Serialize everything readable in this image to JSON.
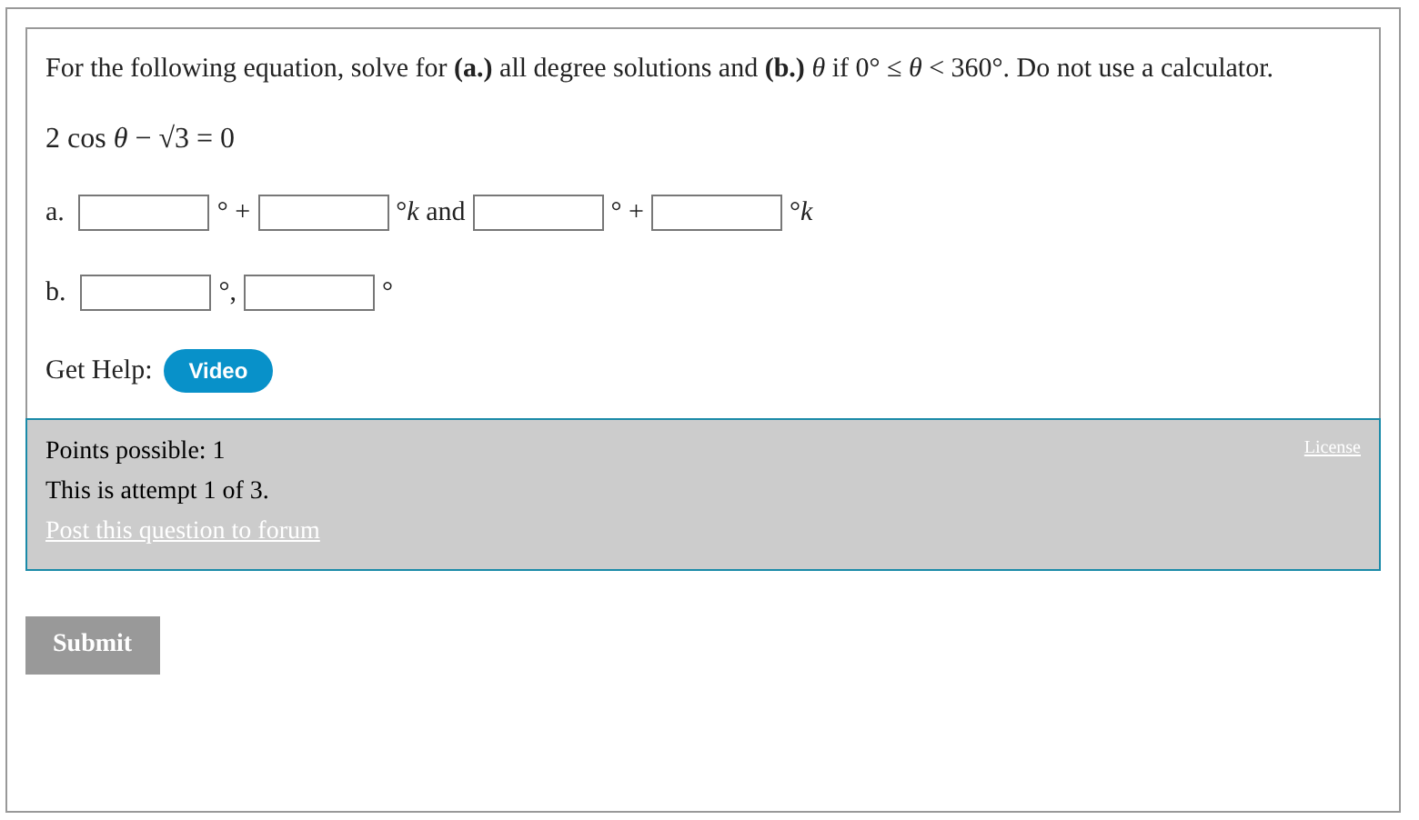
{
  "question": {
    "prompt": "For the following equation, solve for **(a.)** all degree solutions and **(b.)** *θ* if 0° ≤ *θ* < 360°. Do not use a calculator.",
    "equation": "2 cos *θ* − √3 = 0",
    "answer_rows": [
      {
        "label": "a.",
        "parts": [
          {
            "kind": "field"
          },
          {
            "kind": "text",
            "text": "° +"
          },
          {
            "kind": "field"
          },
          {
            "kind": "text",
            "text": "°*k* and"
          },
          {
            "kind": "field"
          },
          {
            "kind": "text",
            "text": "° +"
          },
          {
            "kind": "field"
          },
          {
            "kind": "text",
            "text": "°*k*"
          }
        ]
      },
      {
        "label": "b.",
        "parts": [
          {
            "kind": "field"
          },
          {
            "kind": "text",
            "text": "°,"
          },
          {
            "kind": "field"
          },
          {
            "kind": "text",
            "text": "°"
          }
        ]
      }
    ],
    "help": {
      "label": "Get Help:",
      "buttons": [
        "Video"
      ]
    }
  },
  "footer": {
    "points": "Points possible: 1",
    "attempt": "This is attempt 1 of 3.",
    "forum_link": "Post this question to forum",
    "license_link": "License"
  },
  "submit": "Submit"
}
